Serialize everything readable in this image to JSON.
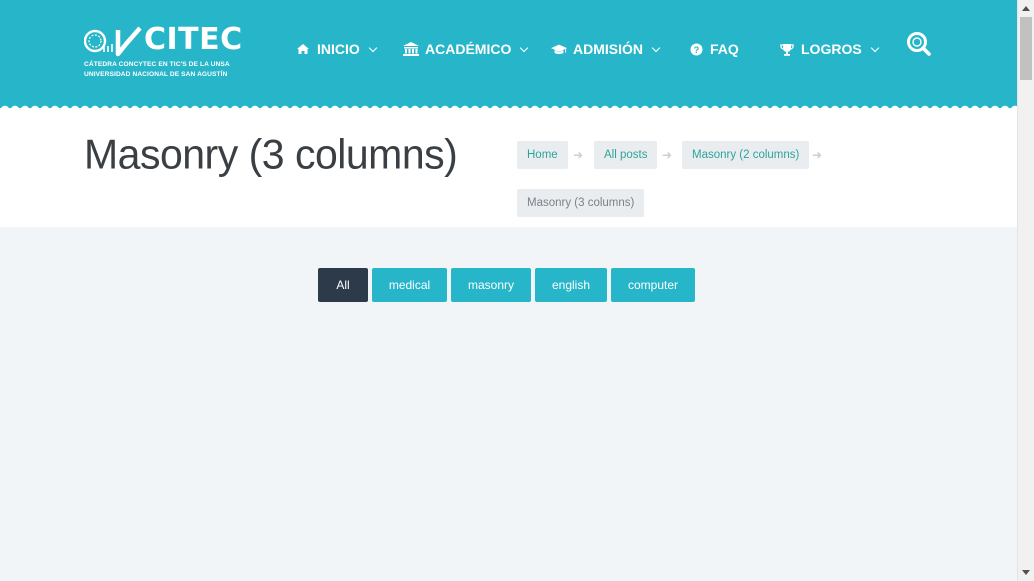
{
  "header": {
    "logo": {
      "name": "CITEC",
      "line1": "CÁTEDRA CONCYTEC EN TIC'S DE LA UNSA",
      "line2": "UNIVERSIDAD NACIONAL DE SAN AGUSTÍN"
    },
    "nav": [
      {
        "label": "INICIO",
        "icon": "home-icon",
        "has_dropdown": true
      },
      {
        "label": "ACADÉMICO",
        "icon": "institution-icon",
        "has_dropdown": true
      },
      {
        "label": "ADMISIÓN",
        "icon": "graduation-cap-icon",
        "has_dropdown": true
      },
      {
        "label": "FAQ",
        "icon": "question-circle-icon",
        "has_dropdown": false
      },
      {
        "label": "LOGROS",
        "icon": "trophy-icon",
        "has_dropdown": true
      }
    ],
    "search_icon": "search-icon",
    "color": "#27b6c9"
  },
  "page": {
    "title": "Masonry (3 columns)"
  },
  "breadcrumb": [
    {
      "label": "Home"
    },
    {
      "label": "All posts"
    },
    {
      "label": "Masonry (2 columns)"
    },
    {
      "label": "Masonry (3 columns)",
      "current": true
    }
  ],
  "filters": [
    {
      "label": "All",
      "active": true
    },
    {
      "label": "medical",
      "active": false
    },
    {
      "label": "masonry",
      "active": false
    },
    {
      "label": "english",
      "active": false
    },
    {
      "label": "computer",
      "active": false
    }
  ],
  "colors": {
    "accent": "#27b6c9",
    "active_filter": "#2d3a4a",
    "breadcrumb_link": "#2fa39b",
    "page_background": "#f2f5f8"
  }
}
